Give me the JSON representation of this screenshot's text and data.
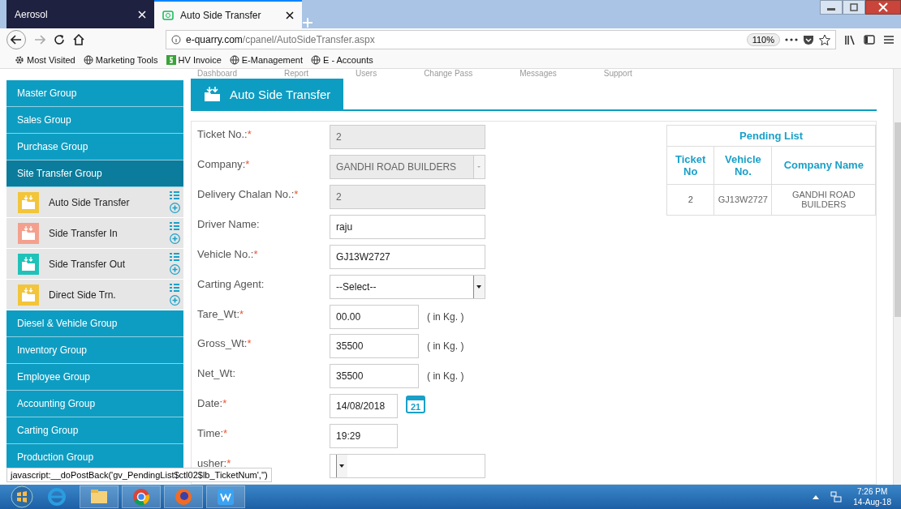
{
  "browser": {
    "tabs": [
      {
        "label": "Aerosol",
        "selected": false
      },
      {
        "label": "Auto Side Transfer",
        "selected": true
      }
    ],
    "url": {
      "host": "e-quarry.com",
      "path": "/cpanel/AutoSideTransfer.aspx"
    },
    "zoom": "110%",
    "bookmarks": [
      {
        "label": "Most Visited",
        "kind": "gear"
      },
      {
        "label": "Marketing Tools",
        "kind": "globe"
      },
      {
        "label": "HV Invoice",
        "kind": "sheet"
      },
      {
        "label": "E-Management",
        "kind": "globe"
      },
      {
        "label": "E - Accounts",
        "kind": "globe"
      }
    ]
  },
  "top_nav": [
    "Dashboard",
    "Report",
    "Users",
    "Change Pass",
    "Messages",
    "Support"
  ],
  "sidebar": {
    "groups": [
      {
        "label": "Master Group",
        "selected": false
      },
      {
        "label": "Sales Group",
        "selected": false
      },
      {
        "label": "Purchase Group",
        "selected": false
      },
      {
        "label": "Site Transfer Group",
        "selected": true,
        "children": [
          {
            "label": "Auto Side Transfer",
            "color": "#f2c53a"
          },
          {
            "label": "Side Transfer In",
            "color": "#f4a08e"
          },
          {
            "label": "Side Transfer Out",
            "color": "#1fc2b8"
          },
          {
            "label": "Direct Side Trn.",
            "color": "#f2c53a"
          }
        ]
      },
      {
        "label": "Diesel & Vehicle Group",
        "selected": false
      },
      {
        "label": "Inventory Group",
        "selected": false
      },
      {
        "label": "Employee Group",
        "selected": false
      },
      {
        "label": "Accounting Group",
        "selected": false
      },
      {
        "label": "Carting Group",
        "selected": false
      },
      {
        "label": "Production Group",
        "selected": false
      }
    ]
  },
  "page_title": "Auto Side Transfer",
  "form": [
    {
      "label": "Ticket No.:",
      "required": "*",
      "kind": "readonly",
      "value": "2"
    },
    {
      "label": "Company:",
      "required": "*",
      "kind": "select-disabled",
      "value": "GANDHI ROAD BUILDERS"
    },
    {
      "label": "Delivery Chalan No.:",
      "required": "*",
      "kind": "readonly",
      "value": "2"
    },
    {
      "label": "Driver Name:",
      "kind": "text",
      "value": "raju"
    },
    {
      "label": "Vehicle No.:",
      "required": "*",
      "kind": "text",
      "value": "GJ13W2727"
    },
    {
      "label": "Carting Agent:",
      "kind": "select",
      "value": "--Select--"
    },
    {
      "label": "Tare_Wt:",
      "required": "*",
      "kind": "short",
      "value": "00.00",
      "unit": "( in Kg. )"
    },
    {
      "label": "Gross_Wt:",
      "required": "*",
      "kind": "short",
      "value": "35500",
      "unit": "( in Kg. )"
    },
    {
      "label": "Net_Wt:",
      "kind": "short",
      "value": "35500",
      "unit": "( in Kg. )"
    },
    {
      "label": "Date:",
      "required": "*",
      "kind": "date",
      "value": "14/08/2018",
      "calendar_day": "21"
    },
    {
      "label": "Time:",
      "required": "*",
      "kind": "time",
      "value": "19:29"
    },
    {
      "label": "usher:",
      "required": "*",
      "kind": "select"
    }
  ],
  "pending_list": {
    "title": "Pending List",
    "columns": [
      "Ticket No",
      "Vehicle No.",
      "Company Name"
    ],
    "rows": [
      [
        "2",
        "GJ13W2727",
        "GANDHI ROAD BUILDERS"
      ]
    ]
  },
  "status_link": "javascript:__doPostBack('gv_PendingList$ctl02$lb_TicketNum','')",
  "taskbar": {
    "time": "7:26 PM",
    "date": "14-Aug-18"
  }
}
